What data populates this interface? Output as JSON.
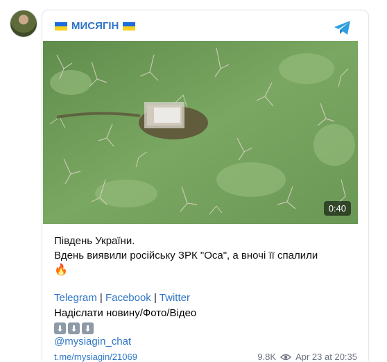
{
  "post": {
    "channel_name": "МИСЯГІН",
    "video_duration": "0:40",
    "text_line1": "Південь України.",
    "text_line2": "Вдень виявили російську ЗРК \"Оса\", а вночі її спалили",
    "fire_emoji": "🔥",
    "links": {
      "telegram": "Telegram",
      "sep1": " | ",
      "facebook": "Facebook",
      "sep2": " | ",
      "twitter": "Twitter"
    },
    "send_news": "Надіслати новину/Фото/Відео",
    "arrows": [
      "⬇",
      "⬇",
      "⬇"
    ],
    "chat_handle": "@mysiagin_chat",
    "post_url": "t.me/mysiagin/21069",
    "views": "9.8K",
    "date": "Apr 23 at 20:35"
  },
  "colors": {
    "link": "#2f76c7",
    "flag_blue": "#1c6ce0",
    "flag_yellow": "#f8d21c"
  },
  "icons": {
    "channel_avatar": "avatar",
    "telegram": "telegram-plane-icon",
    "views": "eye-icon"
  }
}
